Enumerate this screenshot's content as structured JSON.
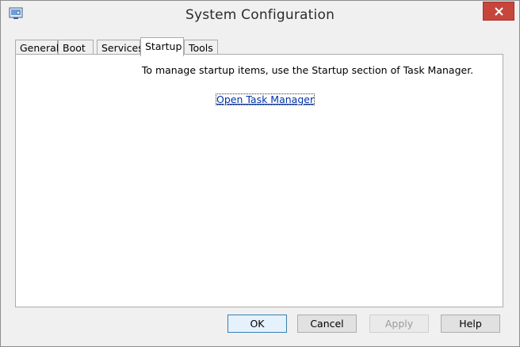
{
  "window": {
    "title": "System Configuration",
    "app_icon": "msconfig-icon",
    "close_icon": "close-icon"
  },
  "tabs": [
    {
      "label": "General",
      "active": false
    },
    {
      "label": "Boot",
      "active": false
    },
    {
      "label": "Services",
      "active": false
    },
    {
      "label": "Startup",
      "active": true
    },
    {
      "label": "Tools",
      "active": false
    }
  ],
  "startup": {
    "message": "To manage startup items, use the Startup section of Task Manager.",
    "link_label": "Open Task Manager"
  },
  "buttons": {
    "ok": "OK",
    "cancel": "Cancel",
    "apply": "Apply",
    "help": "Help"
  },
  "colors": {
    "close_button": "#c7463c",
    "link": "#0033aa",
    "default_button_border": "#3c7fb1"
  }
}
